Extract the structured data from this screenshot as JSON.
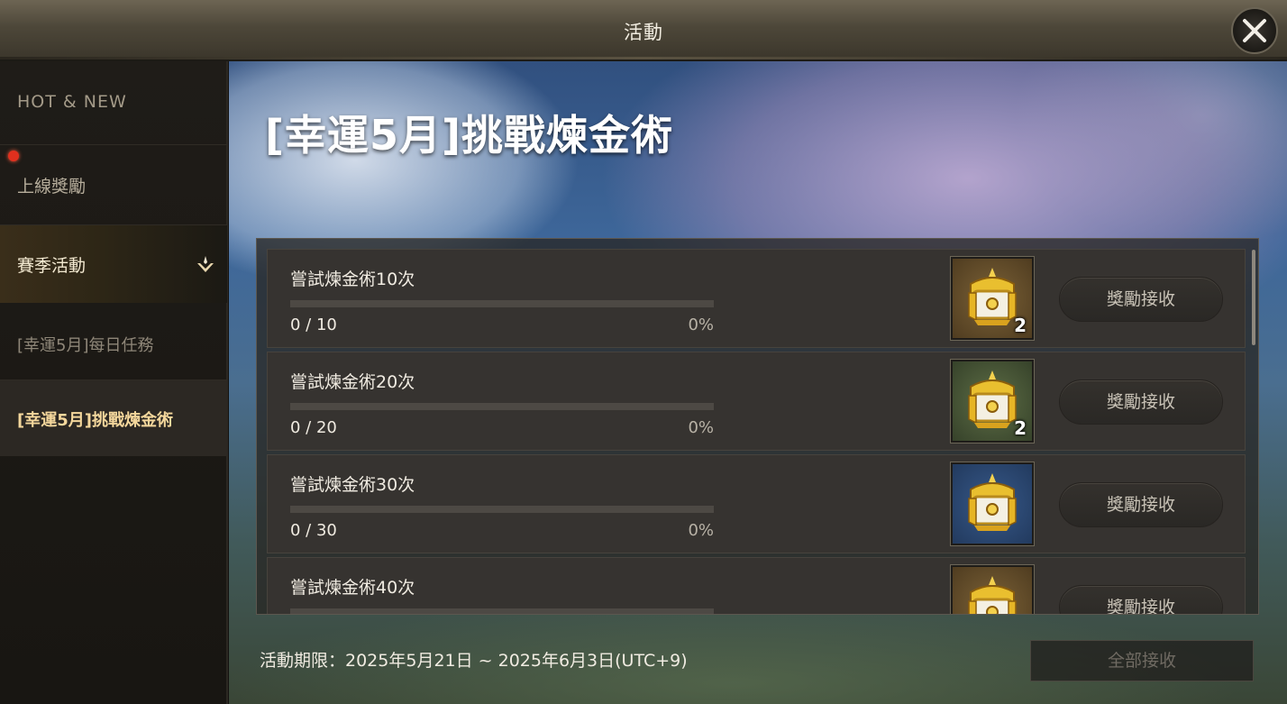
{
  "window": {
    "title": "活動",
    "close_icon": "close-icon"
  },
  "sidebar": {
    "items": [
      {
        "label": "HOT & NEW"
      },
      {
        "label": "上線獎勵",
        "badge": "red-dot"
      },
      {
        "label": "賽季活動",
        "icon": "chevron-down-icon"
      },
      {
        "label": "[幸運5月]每日任務"
      },
      {
        "label": "[幸運5月]挑戰煉金術",
        "selected": true
      }
    ]
  },
  "main": {
    "title": "[幸運5月]挑戰煉金術",
    "missions": [
      {
        "task": "嘗試煉金術10次",
        "progress": "0 / 10",
        "percent": "0%",
        "fraction": 0,
        "reward_icon": "gold-chest-icon",
        "reward_qty": "2",
        "reward_bg": "brown",
        "button": "獎勵接收"
      },
      {
        "task": "嘗試煉金術20次",
        "progress": "0 / 20",
        "percent": "0%",
        "fraction": 0,
        "reward_icon": "gold-chest-icon",
        "reward_qty": "2",
        "reward_bg": "green",
        "button": "獎勵接收"
      },
      {
        "task": "嘗試煉金術30次",
        "progress": "0 / 30",
        "percent": "0%",
        "fraction": 0,
        "reward_icon": "gold-chest-icon",
        "reward_qty": "",
        "reward_bg": "blue",
        "button": "獎勵接收"
      },
      {
        "task": "嘗試煉金術40次",
        "reward_icon": "gold-chest-icon",
        "reward_bg": "brown",
        "button": "獎勵接收"
      }
    ],
    "period": "活動期限：2025年5月21日 ~ 2025年6月3日(UTC+9)",
    "claim_all": "全部接收"
  },
  "colors": {
    "accent_gold": "#f4d79c",
    "progress_fill": "#d6a950",
    "badge_red": "#e0301e"
  }
}
